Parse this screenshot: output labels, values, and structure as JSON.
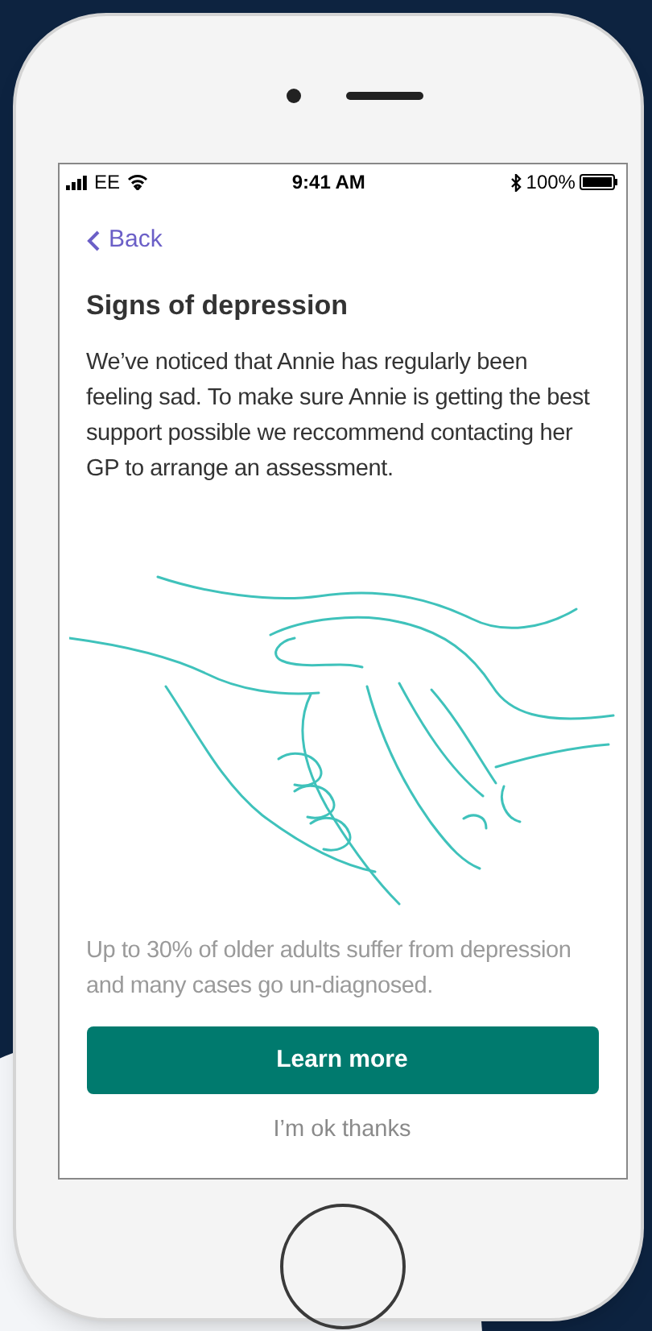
{
  "status_bar": {
    "carrier": "EE",
    "time": "9:41 AM",
    "battery": "100%"
  },
  "back": {
    "label": "Back"
  },
  "title": "Signs of depression",
  "message": "We’ve noticed that Annie has regularly been feeling sad. To make sure Annie is getting the best support possible we reccommend contacting her GP to arrange an assessment.",
  "footnote": "Up to 30% of older adults suffer from depression and many cases go un-diagnosed.",
  "buttons": [
    {
      "kind": "primary",
      "label": "Learn more"
    },
    {
      "kind": "secondary",
      "label": "I’m ok thanks"
    }
  ]
}
